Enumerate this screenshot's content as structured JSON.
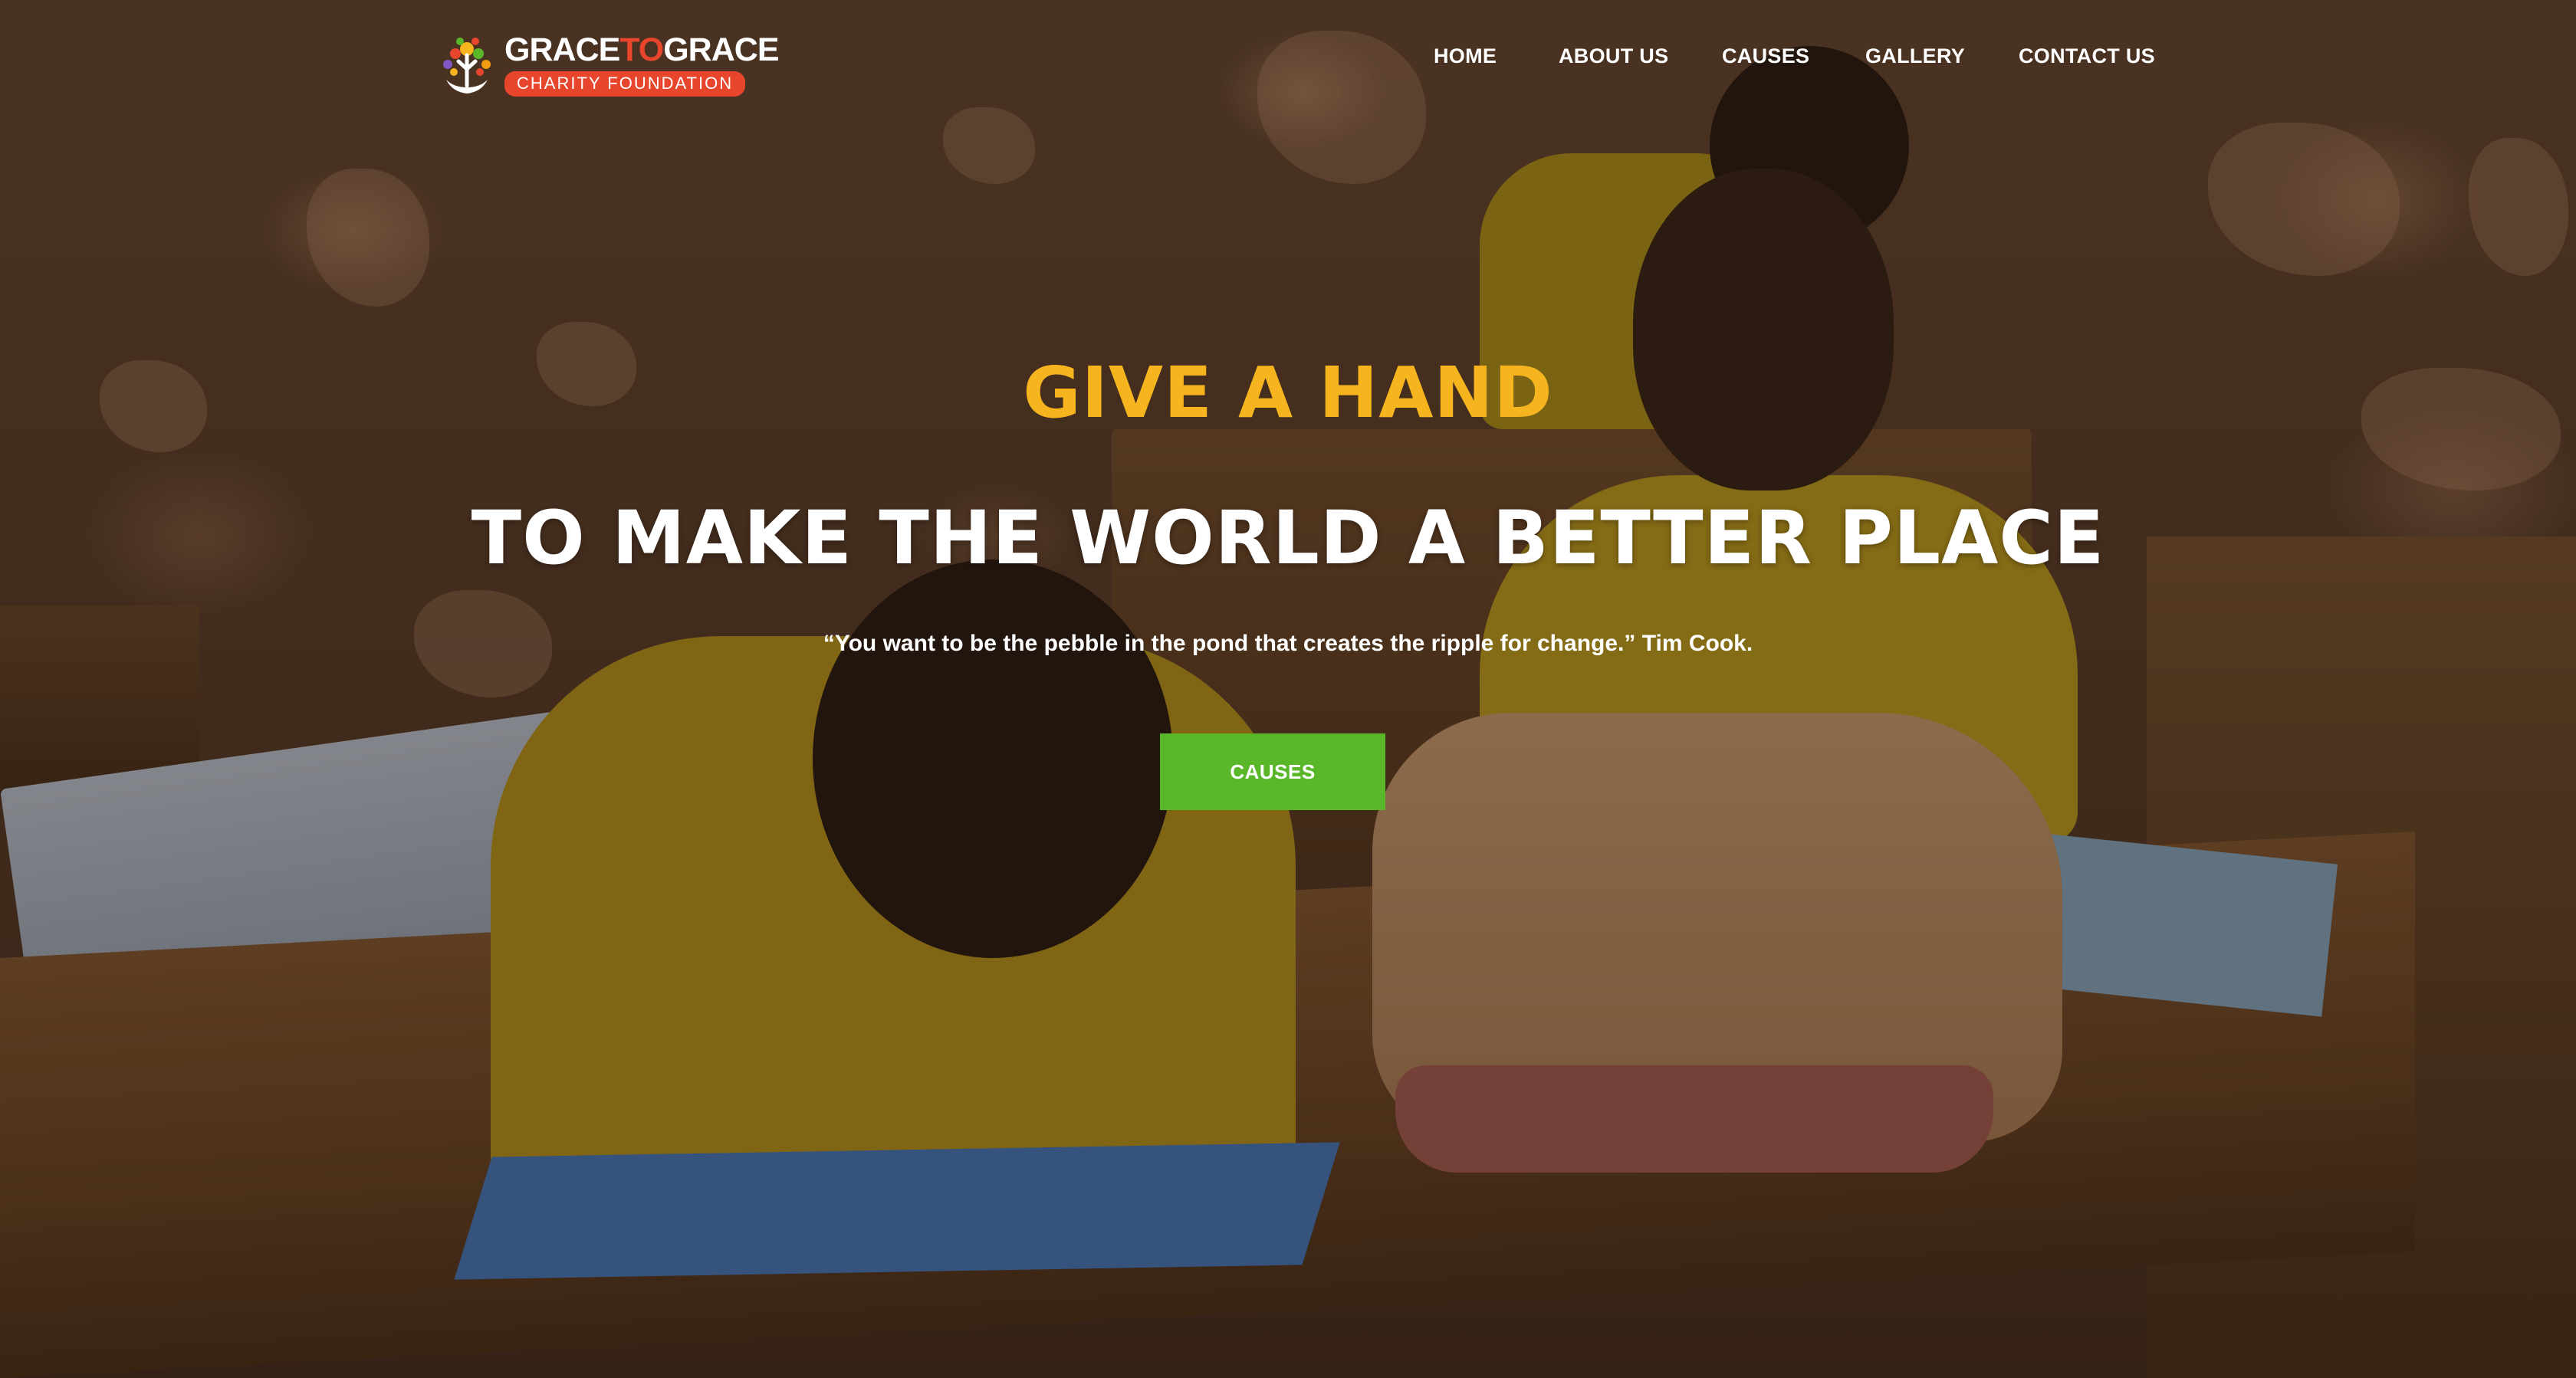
{
  "brand": {
    "word_part1": "GRACE",
    "word_part2": "TO",
    "word_part3": "GRACE",
    "subtitle": "CHARITY FOUNDATION",
    "accent_color": "#e8462c",
    "logo_icon": "tree-hands-icon"
  },
  "nav": {
    "items": [
      {
        "label": "HOME"
      },
      {
        "label": "ABOUT US"
      },
      {
        "label": "CAUSES"
      },
      {
        "label": "GALLERY"
      },
      {
        "label": "CONTACT US"
      }
    ]
  },
  "hero": {
    "kicker": "GIVE A HAND",
    "headline": "TO MAKE THE WORLD A BETTER PLACE",
    "quote": "“You want to be the pebble in the pond that creates the ripple for change.” Tim Cook.",
    "cta_label": "CAUSES",
    "kicker_color": "#f6b51e",
    "cta_color": "#5ab72a"
  }
}
